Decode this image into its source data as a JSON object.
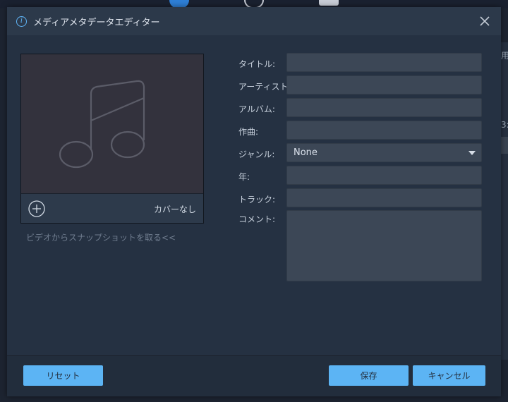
{
  "dialog": {
    "title": "メディアメタデータエディター",
    "icon": "info-icon"
  },
  "background": {
    "right_char_1": "用",
    "right_char_2": "3:"
  },
  "cover": {
    "no_cover_label": "カバーなし",
    "snapshot_link": "ビデオからスナップショットを取る<<",
    "placeholder_icon": "music-note-icon",
    "add_icon": "plus-circle-icon"
  },
  "fields": {
    "title": {
      "label": "タイトル:",
      "value": ""
    },
    "artist": {
      "label": "アーティスト:",
      "value": ""
    },
    "album": {
      "label": "アルバム:",
      "value": ""
    },
    "composer": {
      "label": "作曲:",
      "value": ""
    },
    "genre": {
      "label": "ジャンル:",
      "value": "None"
    },
    "year": {
      "label": "年:",
      "value": ""
    },
    "track": {
      "label": "トラック:",
      "value": ""
    },
    "comment": {
      "label": "コメント:",
      "value": ""
    }
  },
  "buttons": {
    "reset": "リセット",
    "save": "保存",
    "cancel": "キャンセル"
  },
  "colors": {
    "accent": "#5cb4f4",
    "dialog_bg": "#253142",
    "input_bg": "#3c4756"
  }
}
